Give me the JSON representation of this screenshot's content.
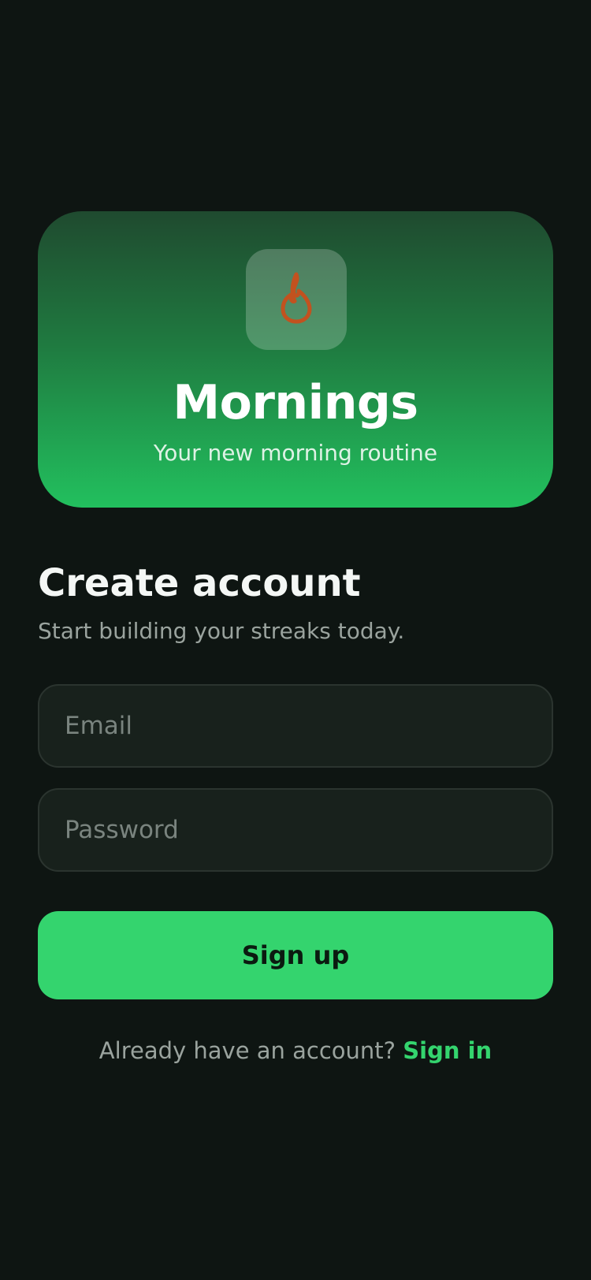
{
  "hero": {
    "icon": "flame-icon",
    "title": "Mornings",
    "subtitle": "Your new morning routine"
  },
  "form": {
    "heading": "Create account",
    "subheading": "Start building your streaks today.",
    "email_placeholder": "Email",
    "email_value": "",
    "password_placeholder": "Password",
    "password_value": "",
    "submit_label": "Sign up"
  },
  "footer": {
    "prompt": "Already have an account?",
    "link_label": "Sign in"
  },
  "colors": {
    "background": "#0e1512",
    "accent": "#34d46e",
    "flame": "#c2521f"
  }
}
